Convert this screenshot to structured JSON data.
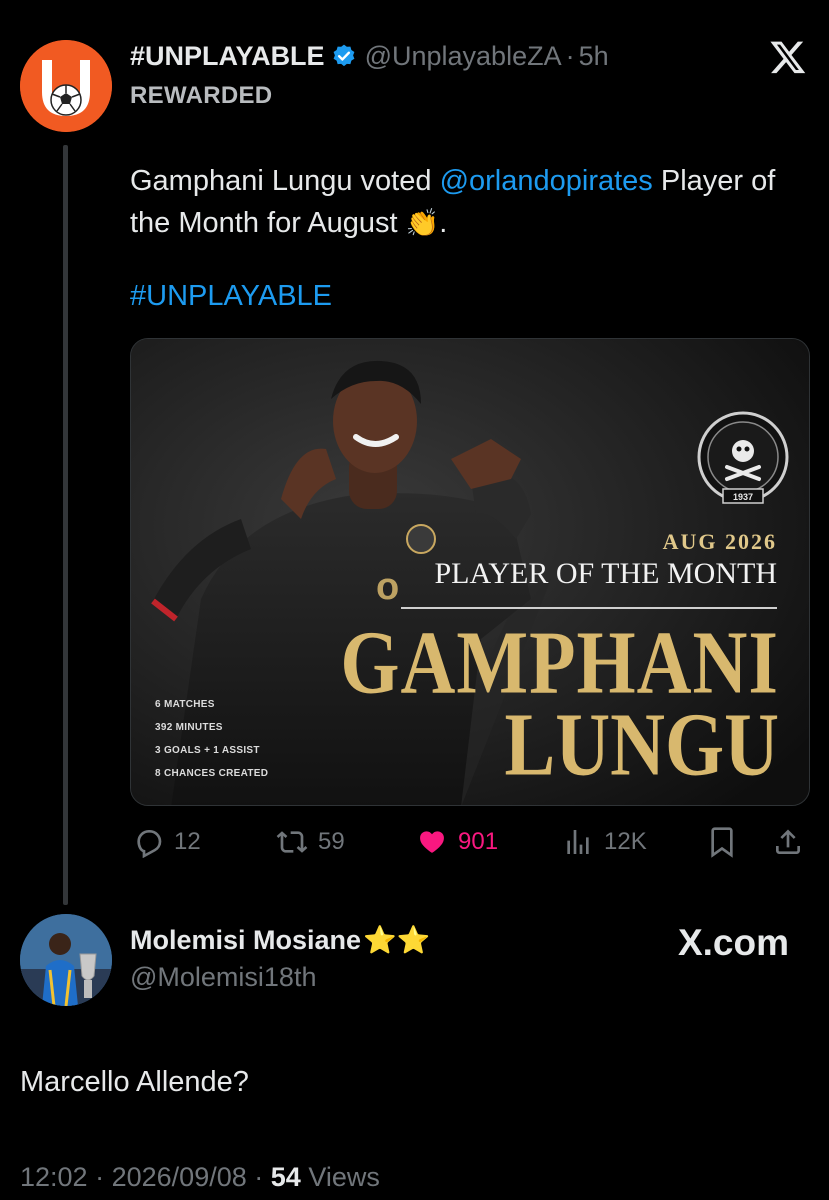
{
  "tweet": {
    "display_name": "#UNPLAYABLE",
    "handle": "@UnplayableZA",
    "separator": "·",
    "time": "5h",
    "sub_label": "REWARDED",
    "text_before_mention": "Gamphani Lungu voted ",
    "mention": "@orlandopirates",
    "text_after_mention": " Player of the Month for August ",
    "emoji": "👏",
    "text_end": ".",
    "hashtag": "#UNPLAYABLE"
  },
  "media": {
    "date": "AUG 2026",
    "title": "PLAYER OF THE MONTH",
    "first_name": "GAMPHANI",
    "last_name": "LUNGU",
    "stats": [
      "6 MATCHES",
      "392 MINUTES",
      "3 GOALS + 1 ASSIST",
      "8 CHANCES CREATED"
    ],
    "crest_text_top": "ORLANDO PIRATES",
    "crest_year": "1937"
  },
  "actions": {
    "replies": "12",
    "reposts": "59",
    "likes": "901",
    "views": "12K"
  },
  "reply": {
    "display_name": "Molemisi Mosiane",
    "stars": "⭐⭐",
    "handle": "@Molemisi18th",
    "watermark": "X.com",
    "text": "Marcello Allende?",
    "time": "12:02",
    "date": "2026/09/08",
    "dot": "·",
    "views_count": "54",
    "views_label": "Views"
  },
  "colors": {
    "background": "#000000",
    "link": "#1d9bf0",
    "like": "#f91880",
    "muted": "#71767b",
    "brand_orange": "#f15a22",
    "gold": "#d8b86e"
  },
  "icons": [
    "verified-badge-icon",
    "x-logo-icon",
    "reply-icon",
    "repost-icon",
    "heart-icon",
    "views-icon",
    "bookmark-icon",
    "share-icon"
  ]
}
